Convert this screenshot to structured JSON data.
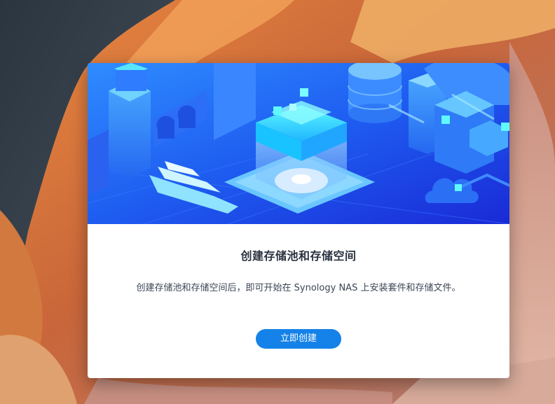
{
  "dialog": {
    "title": "创建存储池和存储空间",
    "description": "创建存储池和存储空间后，即可开始在 Synology NAS 上安装套件和存储文件。",
    "create_button_label": "立即创建"
  },
  "colors": {
    "accent": "#1482e8",
    "hero_dark": "#1a2ad6",
    "hero_light": "#2f8cff",
    "highlight": "#3ff0ff"
  },
  "icons": {
    "hero_illustration": "storage-city-illustration"
  }
}
